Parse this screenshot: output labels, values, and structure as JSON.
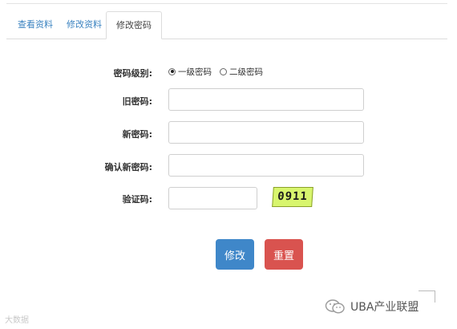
{
  "tabs": [
    {
      "label": "查看资料"
    },
    {
      "label": "修改资料"
    },
    {
      "label": "修改密码"
    }
  ],
  "form": {
    "level_label": "密码级别:",
    "level_options": [
      "一级密码",
      "二级密码"
    ],
    "level_selected": "一级密码",
    "old_label": "旧密码:",
    "old_value": "",
    "new_label": "新密码:",
    "new_value": "",
    "confirm_label": "确认新密码:",
    "confirm_value": "",
    "captcha_label": "验证码:",
    "captcha_value": "",
    "captcha_text": "0911"
  },
  "buttons": {
    "submit": "修改",
    "reset": "重置"
  },
  "watermarks": {
    "left": "大数据",
    "right": "UBA产业联盟"
  },
  "colors": {
    "primary": "#3f87c9",
    "danger": "#d9534f",
    "tab_link": "#3b83c0",
    "captcha_bg": "#d8f56e"
  }
}
